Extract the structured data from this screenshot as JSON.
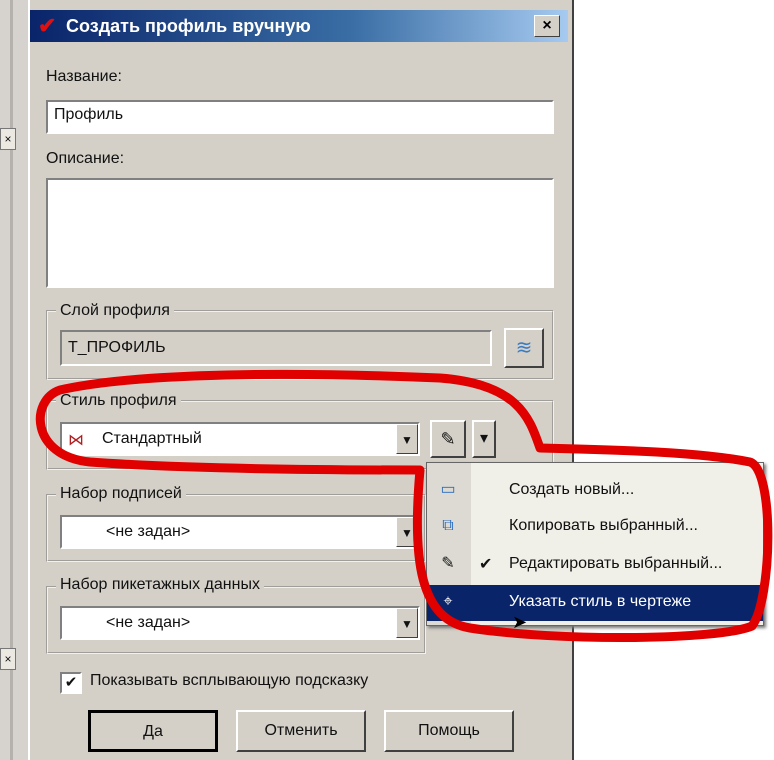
{
  "dialog": {
    "title": "Создать профиль вручную",
    "close_glyph": "×"
  },
  "fields": {
    "name_label": "Название:",
    "name_value": "Профиль",
    "description_label": "Описание:",
    "description_value": ""
  },
  "layer": {
    "group_label": "Слой профиля",
    "value": "Т_ПРОФИЛЬ",
    "button_icon": "layers-icon"
  },
  "style": {
    "group_label": "Стиль профиля",
    "value": "Стандартный",
    "value_icon": "profile-style-icon",
    "edit_icon": "edit-style-icon",
    "dropdown_glyph": "▾"
  },
  "labels_set": {
    "group_label": "Набор подписей",
    "value": "<не задан>"
  },
  "station_set": {
    "group_label": "Набор пикетажных данных",
    "value": "<не задан>"
  },
  "menu": {
    "items": [
      {
        "label": "Создать новый...",
        "icon": "new-style-icon",
        "selected": false,
        "checked": false
      },
      {
        "label": "Копировать выбранный...",
        "icon": "copy-style-icon",
        "selected": false,
        "checked": false
      },
      {
        "label": "Редактировать выбранный...",
        "icon": "edit-style-icon",
        "selected": false,
        "checked": true
      },
      {
        "label": "Указать стиль в чертеже",
        "icon": "pick-style-icon",
        "selected": true,
        "checked": false
      }
    ]
  },
  "tooltip_checkbox": {
    "checked": true,
    "label": "Показывать всплывающую подсказку"
  },
  "buttons": {
    "ok": "Да",
    "cancel": "Отменить",
    "help": "Помощь"
  },
  "colors": {
    "highlight": "#e00000",
    "titlebar": "#0a246a",
    "menu_selection": "#0a246a"
  }
}
